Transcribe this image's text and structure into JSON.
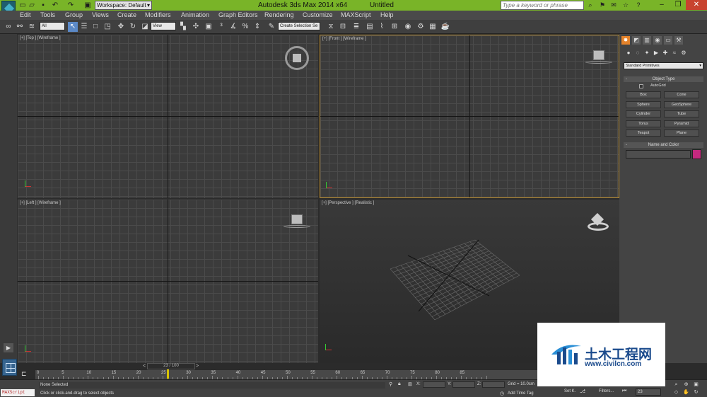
{
  "titlebar": {
    "workspace": "Workspace: Default",
    "app_title": "Autodesk 3ds Max  2014 x64",
    "doc_title": "Untitled",
    "search_placeholder": "Type a keyword or phrase",
    "colors": {
      "bar": "#79b428",
      "close": "#c8432f"
    }
  },
  "menu": [
    "Edit",
    "Tools",
    "Group",
    "Views",
    "Create",
    "Modifiers",
    "Animation",
    "Graph Editors",
    "Rendering",
    "Customize",
    "MAXScript",
    "Help"
  ],
  "toolbar": {
    "selection_filter": "All",
    "ref_coord": "View",
    "named_selection": "Create Selection Se"
  },
  "viewports": {
    "top": {
      "label": "[+] [Top ] [Wireframe ]"
    },
    "front": {
      "label": "[+] [Front ] [Wireframe ]"
    },
    "left": {
      "label": "[+] [Left ] [Wireframe ]"
    },
    "perspective": {
      "label": "[+] [Perspective ] [Realistic ]"
    },
    "active_border_color": "#b78a2e"
  },
  "command_panel": {
    "category": "Standard Primitives",
    "object_type_title": "Object Type",
    "autogrid_label": "AutoGrid",
    "buttons": [
      "Box",
      "Cone",
      "Sphere",
      "GeoSphere",
      "Cylinder",
      "Tube",
      "Torus",
      "Pyramid",
      "Teapot",
      "Plane"
    ],
    "name_color_title": "Name and Color",
    "swatch_color": "#c6297f"
  },
  "timeline": {
    "slider_text": "23 / 100",
    "prev": "<",
    "next": ">",
    "ticks": [
      "0",
      "5",
      "10",
      "15",
      "20",
      "25",
      "30",
      "35",
      "40",
      "45",
      "50",
      "55",
      "60",
      "65",
      "70",
      "75",
      "80",
      "85"
    ]
  },
  "status": {
    "maxscript": "MAXScript",
    "selection": "None Selected",
    "prompt": "Click or click-and-drag to select objects",
    "x_label": "X:",
    "y_label": "Y:",
    "z_label": "Z:",
    "grid": "Grid = 10.0cm",
    "add_time_tag": "Add Time Tag",
    "set_key": "Set K.",
    "filters": "Filters...",
    "frame": "23"
  },
  "watermark": {
    "cn": "土木工程网",
    "url": "www.civilcn.com"
  }
}
